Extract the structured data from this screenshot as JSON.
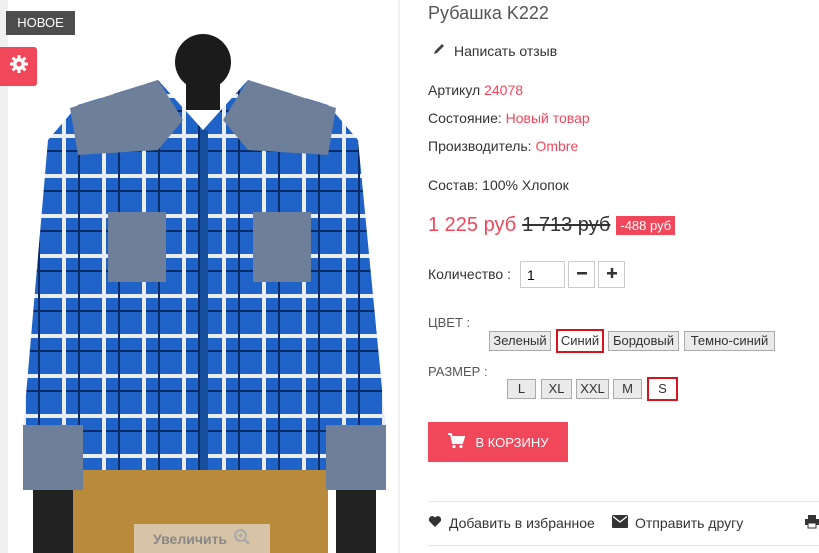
{
  "badge": {
    "new_label": "НОВОЕ"
  },
  "image": {
    "zoom_label": "Увеличить"
  },
  "product": {
    "title": "Рубашка K222",
    "review_label": "Написать отзыв",
    "article_label": "Артикул",
    "article_value": "24078",
    "condition_label": "Состояние:",
    "condition_value": "Новый товар",
    "manufacturer_label": "Производитель:",
    "manufacturer_value": "Ombre",
    "composition": "Состав: 100% Хлопок",
    "price_new": "1 225 руб",
    "price_old": "1 713 руб",
    "discount": "-488 руб"
  },
  "quantity": {
    "label": "Количество :",
    "value": "1",
    "minus": "−",
    "plus": "+"
  },
  "color": {
    "label": "ЦВЕТ :",
    "options": [
      "Зеленый",
      "Синий",
      "Бордовый",
      "Темно-синий"
    ],
    "selected": "Синий"
  },
  "size": {
    "label": "РАЗМЕР :",
    "options": [
      "L",
      "XL",
      "XXL",
      "M",
      "S"
    ],
    "selected": "S"
  },
  "cart": {
    "label": "В КОРЗИНУ"
  },
  "actions": {
    "favorite": "Добавить в избранное",
    "send_friend": "Отправить другу"
  },
  "colors": {
    "accent": "#f1475b",
    "selected_border": "#d9121f",
    "badge_bg": "#4d4d4d"
  }
}
